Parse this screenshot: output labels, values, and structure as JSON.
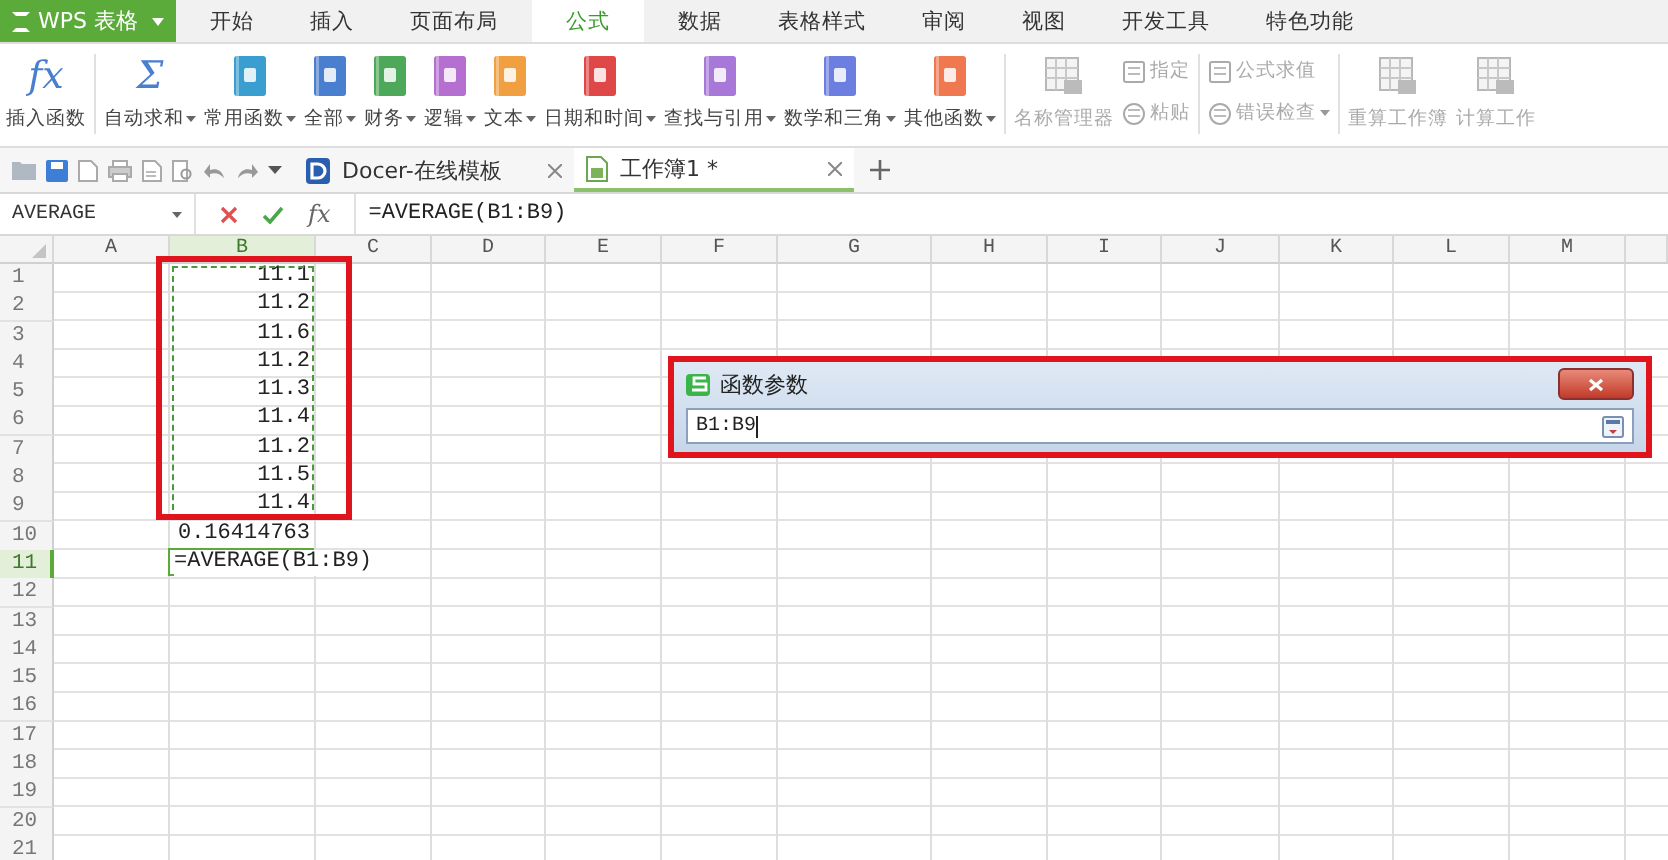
{
  "app": {
    "logo": "WPS 表格"
  },
  "menu_tabs": [
    {
      "label": "开始",
      "selected": false
    },
    {
      "label": "插入",
      "selected": false
    },
    {
      "label": "页面布局",
      "selected": false
    },
    {
      "label": "公式",
      "selected": true
    },
    {
      "label": "数据",
      "selected": false
    },
    {
      "label": "表格样式",
      "selected": false
    },
    {
      "label": "审阅",
      "selected": false
    },
    {
      "label": "视图",
      "selected": false
    },
    {
      "label": "开发工具",
      "selected": false
    },
    {
      "label": "特色功能",
      "selected": false
    }
  ],
  "ribbon": [
    {
      "kind": "glyph",
      "glyph": "fx",
      "label": "插入函数",
      "dropdown": false,
      "disabled": false
    },
    {
      "kind": "separator"
    },
    {
      "kind": "glyph",
      "glyph": "Σ",
      "label": "自动求和",
      "dropdown": true,
      "disabled": false
    },
    {
      "kind": "book",
      "color": "#3a9fd0",
      "label": "常用函数",
      "dropdown": true,
      "disabled": false
    },
    {
      "kind": "book",
      "color": "#4a7fd0",
      "label": "全部",
      "dropdown": true,
      "disabled": false
    },
    {
      "kind": "book",
      "color": "#4ea85a",
      "label": "财务",
      "dropdown": true,
      "disabled": false
    },
    {
      "kind": "book",
      "color": "#b56fd0",
      "label": "逻辑",
      "dropdown": true,
      "disabled": false
    },
    {
      "kind": "book",
      "color": "#f0a040",
      "label": "文本",
      "dropdown": true,
      "disabled": false
    },
    {
      "kind": "book",
      "color": "#e04848",
      "label": "日期和时间",
      "dropdown": true,
      "disabled": false
    },
    {
      "kind": "book",
      "color": "#a778d8",
      "label": "查找与引用",
      "dropdown": true,
      "disabled": false
    },
    {
      "kind": "book",
      "color": "#6c7fe0",
      "label": "数学和三角",
      "dropdown": true,
      "disabled": false
    },
    {
      "kind": "book",
      "color": "#f07850",
      "label": "其他函数",
      "dropdown": true,
      "disabled": false
    },
    {
      "kind": "separator"
    },
    {
      "kind": "tool",
      "label": "名称管理器",
      "dropdown": false,
      "disabled": true
    },
    {
      "kind": "pair",
      "items": [
        {
          "label": "指定",
          "dropdown": false,
          "disabled": true
        },
        {
          "label": "粘贴",
          "dropdown": false,
          "disabled": true
        }
      ]
    },
    {
      "kind": "separator"
    },
    {
      "kind": "pair",
      "items": [
        {
          "label": "公式求值",
          "dropdown": false,
          "disabled": true
        },
        {
          "label": "错误检查",
          "dropdown": true,
          "disabled": true
        }
      ]
    },
    {
      "kind": "separator"
    },
    {
      "kind": "tool",
      "label": "重算工作簿",
      "dropdown": false,
      "disabled": true
    },
    {
      "kind": "tool",
      "label": "计算工作",
      "dropdown": false,
      "disabled": true
    }
  ],
  "doc_tabs": [
    {
      "kind": "docer",
      "label": "Docer-在线模板",
      "selected": false
    },
    {
      "kind": "sheet",
      "label": "工作簿1 *",
      "selected": true
    }
  ],
  "formula_bar": {
    "name_box": "AVERAGE",
    "fx": "fx",
    "formula": "=AVERAGE(B1:B9)"
  },
  "sheet": {
    "columns": [
      {
        "label": "A",
        "selected": false
      },
      {
        "label": "B",
        "selected": true
      },
      {
        "label": "C",
        "selected": false
      },
      {
        "label": "D",
        "selected": false
      },
      {
        "label": "E",
        "selected": false
      },
      {
        "label": "F",
        "selected": false
      },
      {
        "label": "G",
        "selected": false
      },
      {
        "label": "H",
        "selected": false
      },
      {
        "label": "I",
        "selected": false
      },
      {
        "label": "J",
        "selected": false
      },
      {
        "label": "K",
        "selected": false
      },
      {
        "label": "L",
        "selected": false
      },
      {
        "label": "M",
        "selected": false
      }
    ],
    "rows": [
      {
        "label": "1",
        "selected": false,
        "b": "11.1"
      },
      {
        "label": "2",
        "selected": false,
        "b": "11.2"
      },
      {
        "label": "3",
        "selected": false,
        "b": "11.6"
      },
      {
        "label": "4",
        "selected": false,
        "b": "11.2"
      },
      {
        "label": "5",
        "selected": false,
        "b": "11.3"
      },
      {
        "label": "6",
        "selected": false,
        "b": "11.4"
      },
      {
        "label": "7",
        "selected": false,
        "b": "11.2"
      },
      {
        "label": "8",
        "selected": false,
        "b": "11.5"
      },
      {
        "label": "9",
        "selected": false,
        "b": "11.4"
      },
      {
        "label": "10",
        "selected": false,
        "b": "0.16414763"
      },
      {
        "label": "11",
        "selected": true,
        "b": "=AVERAGE(B1:B9)"
      },
      {
        "label": "12",
        "selected": false
      },
      {
        "label": "13",
        "selected": false
      },
      {
        "label": "14",
        "selected": false
      },
      {
        "label": "15",
        "selected": false
      },
      {
        "label": "16",
        "selected": false
      },
      {
        "label": "17",
        "selected": false
      },
      {
        "label": "18",
        "selected": false
      },
      {
        "label": "19",
        "selected": false
      },
      {
        "label": "20",
        "selected": false
      },
      {
        "label": "21",
        "selected": false
      }
    ]
  },
  "dialog": {
    "title": "函数参数",
    "value": "B1:B9"
  }
}
